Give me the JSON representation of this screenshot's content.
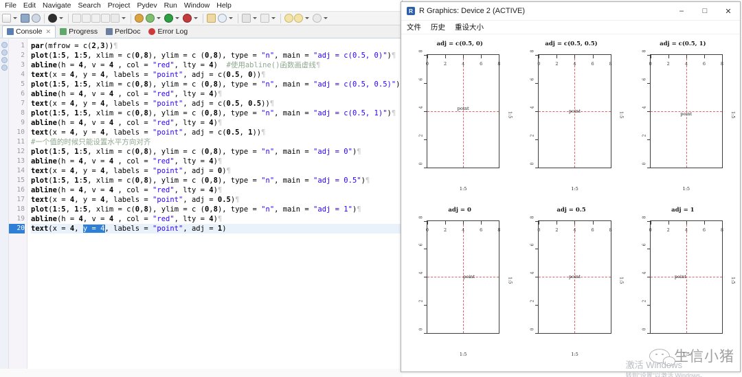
{
  "ide": {
    "menus": [
      "File",
      "Edit",
      "Navigate",
      "Search",
      "Project",
      "Pydev",
      "Run",
      "Window",
      "Help"
    ],
    "tabs": [
      {
        "label": "Console",
        "icon": "console-icon",
        "active": true
      },
      {
        "label": "Progress",
        "icon": "progress-icon",
        "active": false
      },
      {
        "label": "PerlDoc",
        "icon": "perldoc-icon",
        "active": false
      },
      {
        "label": "Error Log",
        "icon": "error-log-icon",
        "active": false
      }
    ],
    "current_line": 20,
    "selection": "y = 4",
    "lines": [
      {
        "n": 1,
        "text": "par(mfrow = c(2,3))"
      },
      {
        "n": 2,
        "text": "plot(1:5, 1:5, xlim = c(0,8), ylim = c (0,8), type = \"n\", main = \"adj = c(0.5, 0)\")"
      },
      {
        "n": 3,
        "text": "abline(h = 4, v = 4 , col = \"red\", lty = 4)  #使用abline()函数画虚线"
      },
      {
        "n": 4,
        "text": "text(x = 4, y = 4, labels = \"point\", adj = c(0.5, 0))"
      },
      {
        "n": 5,
        "text": "plot(1:5, 1:5, xlim = c(0,8), ylim = c (0,8), type = \"n\", main = \"adj = c(0.5, 0.5)\")"
      },
      {
        "n": 6,
        "text": "abline(h = 4, v = 4 , col = \"red\", lty = 4)"
      },
      {
        "n": 7,
        "text": "text(x = 4, y = 4, labels = \"point\", adj = c(0.5, 0.5))"
      },
      {
        "n": 8,
        "text": "plot(1:5, 1:5, xlim = c(0,8), ylim = c (0,8), type = \"n\", main = \"adj = c(0.5, 1)\")"
      },
      {
        "n": 9,
        "text": "abline(h = 4, v = 4 , col = \"red\", lty = 4)"
      },
      {
        "n": 10,
        "text": "text(x = 4, y = 4, labels = \"point\", adj = c(0.5, 1))"
      },
      {
        "n": 11,
        "text": "#一个值的时候只能设置水平方向对齐"
      },
      {
        "n": 12,
        "text": "plot(1:5, 1:5, xlim = c(0,8), ylim = c (0,8), type = \"n\", main = \"adj = 0\")"
      },
      {
        "n": 13,
        "text": "abline(h = 4, v = 4 , col = \"red\", lty = 4)"
      },
      {
        "n": 14,
        "text": "text(x = 4, y = 4, labels = \"point\", adj = 0)"
      },
      {
        "n": 15,
        "text": "plot(1:5, 1:5, xlim = c(0,8), ylim = c (0,8), type = \"n\", main = \"adj = 0.5\")"
      },
      {
        "n": 16,
        "text": "abline(h = 4, v = 4 , col = \"red\", lty = 4)"
      },
      {
        "n": 17,
        "text": "text(x = 4, y = 4, labels = \"point\", adj = 0.5)"
      },
      {
        "n": 18,
        "text": "plot(1:5, 1:5, xlim = c(0,8), ylim = c (0,8), type = \"n\", main = \"adj = 1\")"
      },
      {
        "n": 19,
        "text": "abline(h = 4, v = 4 , col = \"red\", lty = 4)"
      },
      {
        "n": 20,
        "text": "text(x = 4, y = 4, labels = \"point\", adj = 1)"
      }
    ]
  },
  "rwindow": {
    "title": "R Graphics: Device 2 (ACTIVE)",
    "icon_letter": "R",
    "menus": [
      "文件",
      "历史",
      "重设大小"
    ],
    "minimize": "–",
    "maximize": "□",
    "close": "✕"
  },
  "watermark": {
    "text": "生信小猪",
    "icon": "wechat-icon"
  },
  "activate_windows": {
    "line1": "激活 Windows",
    "line2": "转到\"设置\"以激活 Windows。"
  },
  "chart_data": [
    {
      "type": "scatter",
      "title": "adj = c(0.5, 0)",
      "xlabel": "1:5",
      "ylabel": "1:5",
      "xlim": [
        0,
        8
      ],
      "ylim": [
        0,
        8
      ],
      "xticks": [
        0,
        2,
        4,
        6,
        8
      ],
      "yticks": [
        0,
        2,
        4,
        6,
        8
      ],
      "grid": false,
      "hline": 4,
      "vline": 4,
      "line_color": "#e06666",
      "line_type": "dashed",
      "annotations": [
        {
          "text": "point",
          "x": 4,
          "y": 4,
          "adj": [
            0.5,
            0
          ]
        }
      ]
    },
    {
      "type": "scatter",
      "title": "adj = c(0.5, 0.5)",
      "xlabel": "1:5",
      "ylabel": "1:5",
      "xlim": [
        0,
        8
      ],
      "ylim": [
        0,
        8
      ],
      "xticks": [
        0,
        2,
        4,
        6,
        8
      ],
      "yticks": [
        0,
        2,
        4,
        6,
        8
      ],
      "grid": false,
      "hline": 4,
      "vline": 4,
      "line_color": "#e06666",
      "line_type": "dashed",
      "annotations": [
        {
          "text": "point",
          "x": 4,
          "y": 4,
          "adj": [
            0.5,
            0.5
          ]
        }
      ]
    },
    {
      "type": "scatter",
      "title": "adj = c(0.5, 1)",
      "xlabel": "1:5",
      "ylabel": "1:5",
      "xlim": [
        0,
        8
      ],
      "ylim": [
        0,
        8
      ],
      "xticks": [
        0,
        2,
        4,
        6,
        8
      ],
      "yticks": [
        0,
        2,
        4,
        6,
        8
      ],
      "grid": false,
      "hline": 4,
      "vline": 4,
      "line_color": "#e06666",
      "line_type": "dashed",
      "annotations": [
        {
          "text": "point",
          "x": 4,
          "y": 4,
          "adj": [
            0.5,
            1
          ]
        }
      ]
    },
    {
      "type": "scatter",
      "title": "adj = 0",
      "xlabel": "1:5",
      "ylabel": "1:5",
      "xlim": [
        0,
        8
      ],
      "ylim": [
        0,
        8
      ],
      "xticks": [
        0,
        2,
        4,
        6,
        8
      ],
      "yticks": [
        0,
        2,
        4,
        6,
        8
      ],
      "grid": false,
      "hline": 4,
      "vline": 4,
      "line_color": "#e06666",
      "line_type": "dashed",
      "annotations": [
        {
          "text": "point",
          "x": 4,
          "y": 4,
          "adj": [
            0,
            0.5
          ]
        }
      ]
    },
    {
      "type": "scatter",
      "title": "adj = 0.5",
      "xlabel": "1:5",
      "ylabel": "1:5",
      "xlim": [
        0,
        8
      ],
      "ylim": [
        0,
        8
      ],
      "xticks": [
        0,
        2,
        4,
        6,
        8
      ],
      "yticks": [
        0,
        2,
        4,
        6,
        8
      ],
      "grid": false,
      "hline": 4,
      "vline": 4,
      "line_color": "#e06666",
      "line_type": "dashed",
      "annotations": [
        {
          "text": "point",
          "x": 4,
          "y": 4,
          "adj": [
            0.5,
            0.5
          ]
        }
      ]
    },
    {
      "type": "scatter",
      "title": "adj = 1",
      "xlabel": "1:5",
      "ylabel": "1:5",
      "xlim": [
        0,
        8
      ],
      "ylim": [
        0,
        8
      ],
      "xticks": [
        0,
        2,
        4,
        6,
        8
      ],
      "yticks": [
        0,
        2,
        4,
        6,
        8
      ],
      "grid": false,
      "hline": 4,
      "vline": 4,
      "line_color": "#e06666",
      "line_type": "dashed",
      "annotations": [
        {
          "text": "point",
          "x": 4,
          "y": 4,
          "adj": [
            1,
            0.5
          ]
        }
      ]
    }
  ]
}
